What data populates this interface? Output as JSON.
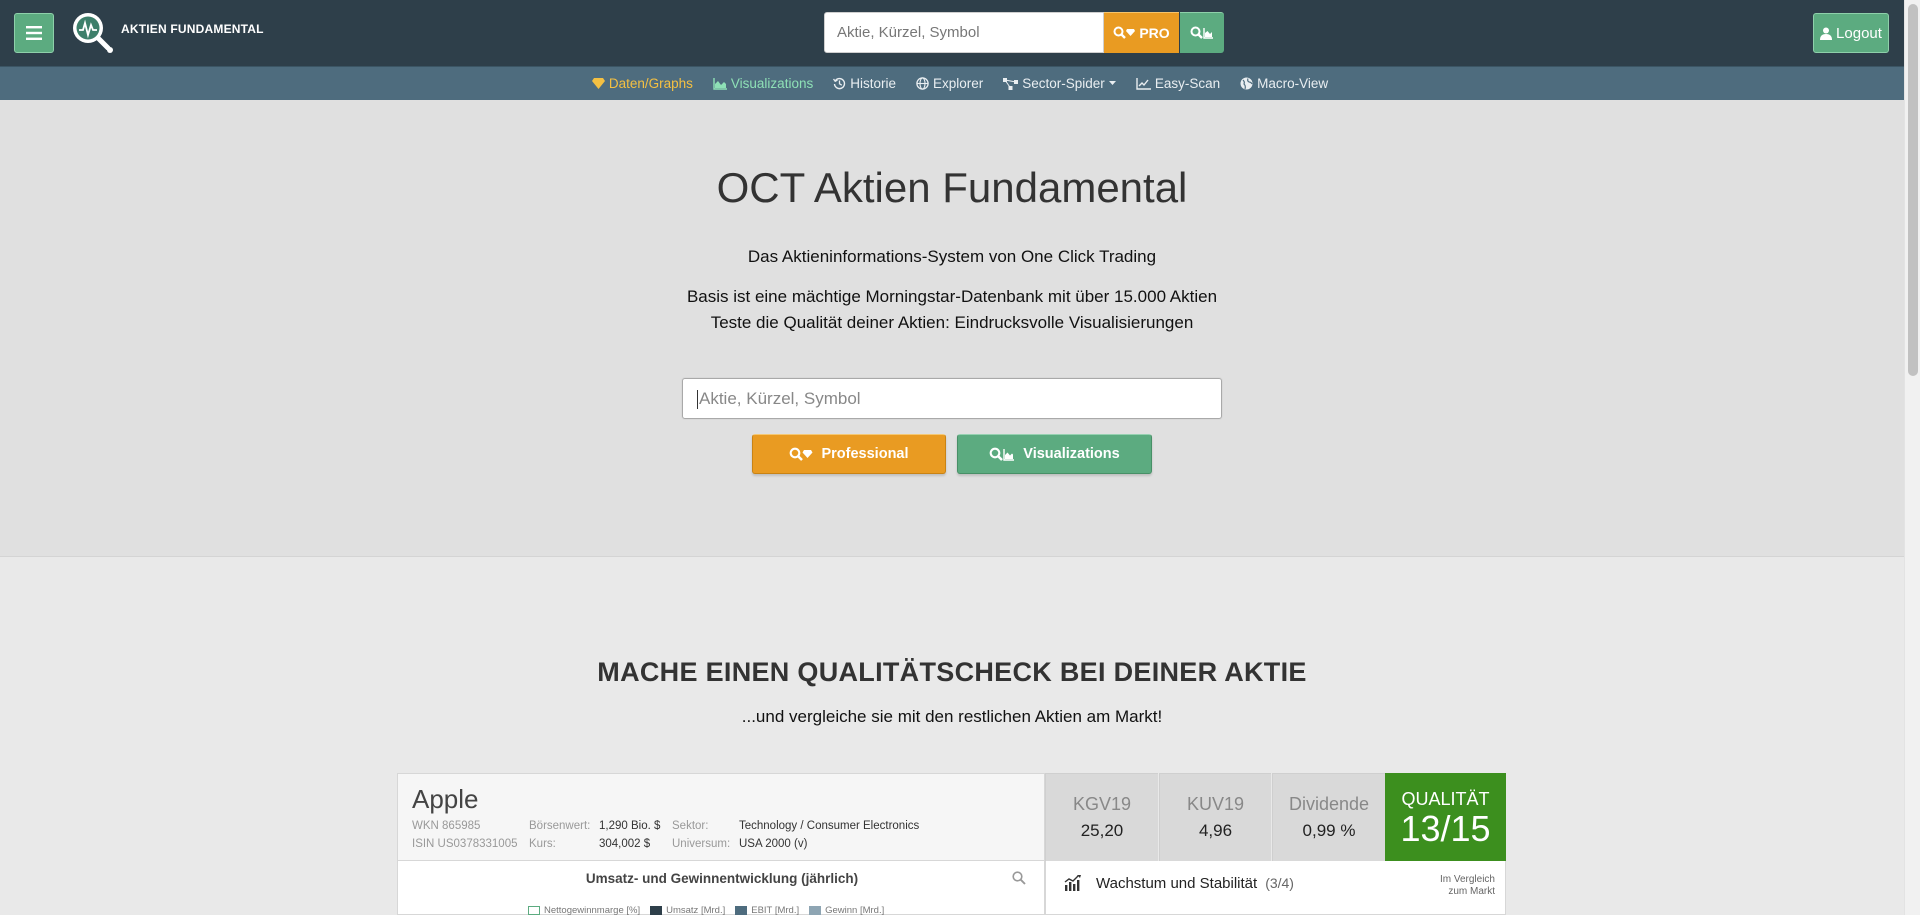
{
  "header": {
    "logo_text": "AKTIEN FUNDAMENTAL",
    "search_placeholder": "Aktie, Kürzel, Symbol",
    "pro_label": "PRO",
    "logout_label": "Logout"
  },
  "nav": {
    "items": [
      {
        "label": "Daten/Graphs",
        "icon": "gem-icon"
      },
      {
        "label": "Visualizations",
        "icon": "area-chart-icon"
      },
      {
        "label": "Historie",
        "icon": "history-icon"
      },
      {
        "label": "Explorer",
        "icon": "globe-icon"
      },
      {
        "label": "Sector-Spider",
        "icon": "sitemap-icon"
      },
      {
        "label": "Easy-Scan",
        "icon": "line-chart-icon"
      },
      {
        "label": "Macro-View",
        "icon": "globe-icon"
      }
    ]
  },
  "hero": {
    "title": "OCT Aktien Fundamental",
    "line1": "Das Aktieninformations-System von One Click Trading",
    "line2": "Basis ist eine mächtige Morningstar-Datenbank mit über 15.000 Aktien",
    "line3": "Teste die Qualität deiner Aktien: Eindrucksvolle Visualisierungen",
    "search_placeholder": "Aktie, Kürzel, Symbol",
    "btn_professional": "Professional",
    "btn_visualizations": "Visualizations"
  },
  "section": {
    "title": "MACHE EINEN QUALITÄTSCHECK BEI DEINER AKTIE",
    "subtitle": "...und vergleiche sie mit den restlichen Aktien am Markt!"
  },
  "stock": {
    "name": "Apple",
    "wkn": "WKN 865985",
    "isin": "ISIN US0378331005",
    "market_cap_label": "Börsenwert:",
    "market_cap_value": "1,290 Bio. $",
    "price_label": "Kurs:",
    "price_value": "304,002 $",
    "sector_label": "Sektor:",
    "sector_value": "Technology / Consumer Electronics",
    "universe_label": "Universum:",
    "universe_value": "USA 2000 (v)",
    "metrics": [
      {
        "label": "KGV19",
        "value": "25,20"
      },
      {
        "label": "KUV19",
        "value": "4,96"
      },
      {
        "label": "Dividende",
        "value": "0,99 %"
      }
    ],
    "quality_label": "QUALITÄT",
    "quality_value": "13/15"
  },
  "panels": {
    "left_title": "Umsatz- und Gewinnentwicklung (jährlich)",
    "legend": [
      "Nettogewinnmarge [%]",
      "Umsatz [Mrd.]",
      "EBIT [Mrd.]",
      "Gewinn [Mrd.]"
    ],
    "right_title": "Wachstum und Stabilität",
    "right_count": "(3/4)",
    "right_note_1": "Im Vergleich",
    "right_note_2": "zum Markt"
  },
  "colors": {
    "header_bg": "#2e3f4a",
    "subnav_bg": "#4e6c7e",
    "accent_orange": "#e99b22",
    "accent_green": "#5cab80",
    "quality_green": "#3c8f1e"
  }
}
